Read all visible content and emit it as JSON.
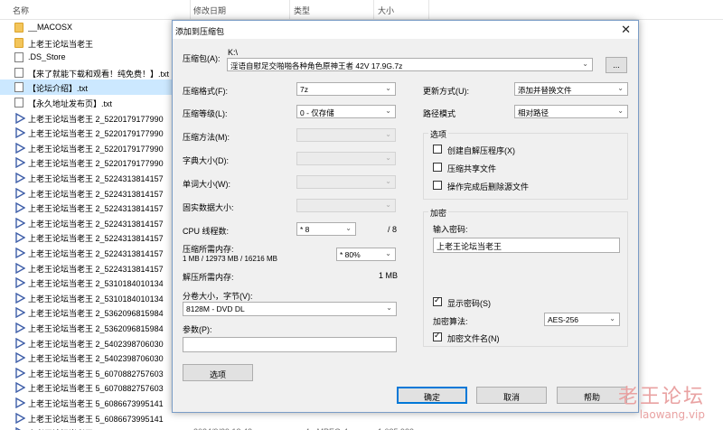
{
  "explorer": {
    "columns": {
      "name": "名称",
      "date": "修改日期",
      "type": "类型",
      "size": "大小"
    },
    "files": [
      {
        "icon": "folder-icon",
        "name": "__MACOSX",
        "date": "",
        "type": "",
        "size": ""
      },
      {
        "icon": "folder-icon",
        "name": "上老王论坛当老王",
        "date": "",
        "type": "",
        "size": ""
      },
      {
        "icon": "document-icon",
        "name": ".DS_Store",
        "date": "",
        "type": "",
        "size": ""
      },
      {
        "icon": "document-icon",
        "name": "【来了就能下载和观看！纯免费！】.txt",
        "date": "",
        "type": "",
        "size": ""
      },
      {
        "icon": "document-icon",
        "name": "【论坛介绍】.txt",
        "date": "",
        "type": "",
        "size": ""
      },
      {
        "icon": "document-icon",
        "name": "【永久地址发布页】.txt",
        "date": "",
        "type": "",
        "size": ""
      },
      {
        "icon": "video-icon",
        "name": "上老王论坛当老王 2_5220179177990",
        "date": "",
        "type": "",
        "size": ""
      },
      {
        "icon": "video-icon",
        "name": "上老王论坛当老王 2_5220179177990",
        "date": "",
        "type": "",
        "size": ""
      },
      {
        "icon": "video-icon",
        "name": "上老王论坛当老王 2_5220179177990",
        "date": "",
        "type": "",
        "size": ""
      },
      {
        "icon": "video-icon",
        "name": "上老王论坛当老王 2_5220179177990",
        "date": "",
        "type": "",
        "size": ""
      },
      {
        "icon": "video-icon",
        "name": "上老王论坛当老王 2_5224313814157",
        "date": "",
        "type": "",
        "size": ""
      },
      {
        "icon": "video-icon",
        "name": "上老王论坛当老王 2_5224313814157",
        "date": "",
        "type": "",
        "size": ""
      },
      {
        "icon": "video-icon",
        "name": "上老王论坛当老王 2_5224313814157",
        "date": "",
        "type": "",
        "size": ""
      },
      {
        "icon": "video-icon",
        "name": "上老王论坛当老王 2_5224313814157",
        "date": "",
        "type": "",
        "size": ""
      },
      {
        "icon": "video-icon",
        "name": "上老王论坛当老王 2_5224313814157",
        "date": "",
        "type": "",
        "size": ""
      },
      {
        "icon": "video-icon",
        "name": "上老王论坛当老王 2_5224313814157",
        "date": "",
        "type": "",
        "size": ""
      },
      {
        "icon": "video-icon",
        "name": "上老王论坛当老王 2_5224313814157",
        "date": "",
        "type": "",
        "size": ""
      },
      {
        "icon": "video-icon",
        "name": "上老王论坛当老王 2_5310184010134",
        "date": "",
        "type": "",
        "size": ""
      },
      {
        "icon": "video-icon",
        "name": "上老王论坛当老王 2_5310184010134",
        "date": "",
        "type": "",
        "size": ""
      },
      {
        "icon": "video-icon",
        "name": "上老王论坛当老王 2_5362096815984",
        "date": "",
        "type": "",
        "size": ""
      },
      {
        "icon": "video-icon",
        "name": "上老王论坛当老王 2_5362096815984",
        "date": "",
        "type": "",
        "size": ""
      },
      {
        "icon": "video-icon",
        "name": "上老王论坛当老王 2_5402398706030",
        "date": "",
        "type": "",
        "size": ""
      },
      {
        "icon": "video-icon",
        "name": "上老王论坛当老王 2_5402398706030",
        "date": "",
        "type": "",
        "size": ""
      },
      {
        "icon": "video-icon",
        "name": "上老王论坛当老王 5_6070882757603",
        "date": "",
        "type": "",
        "size": ""
      },
      {
        "icon": "video-icon",
        "name": "上老王论坛当老王 5_6070882757603",
        "date": "",
        "type": "",
        "size": ""
      },
      {
        "icon": "video-icon",
        "name": "上老王论坛当老王 5_6086673995141",
        "date": "",
        "type": "",
        "size": ""
      },
      {
        "icon": "video-icon",
        "name": "上老王论坛当老王 5_6086673995141",
        "date": "",
        "type": "",
        "size": ""
      },
      {
        "icon": "video-icon",
        "name": "上老王论坛当老王 5_60983134982473...",
        "date": "2024/9/29 13:42",
        "type": "mp4 - MPEG-4 ...",
        "size": "1,035,933..."
      }
    ]
  },
  "dialog": {
    "title": "添加到压缩包",
    "archive_label": "压缩包(A):",
    "archive_path_prefix": "K:\\",
    "archive_name": "淫语自慰足交啪啪各种角色原神王者  42V 17.9G.7z",
    "browse_button": "...",
    "format_label": "压缩格式(F):",
    "format_value": "7z",
    "level_label": "压缩等级(L):",
    "level_value": "0 - 仅存储",
    "method_label": "压缩方法(M):",
    "dict_label": "字典大小(D):",
    "word_label": "单词大小(W):",
    "solid_label": "固实数据大小:",
    "threads_label": "CPU 线程数:",
    "threads_value": "* 8",
    "threads_max": "/ 8",
    "mem_comp_label": "压缩所需内存:",
    "mem_comp_detail": "1 MB / 12973 MB / 16216 MB",
    "mem_percent": "* 80%",
    "mem_decomp_label": "解压所需内存:",
    "mem_decomp_value": "1 MB",
    "split_label": "分卷大小，字节(V):",
    "split_value": "8128M - DVD DL",
    "params_label": "参数(P):",
    "params_value": "",
    "options_button": "选项",
    "update_label": "更新方式(U):",
    "update_value": "添加并替换文件",
    "path_label": "路径模式",
    "path_value": "相对路径",
    "options_group": "选项",
    "opt_sfx": "创建自解压程序(X)",
    "opt_shared": "压缩共享文件",
    "opt_delete": "操作完成后删除源文件",
    "encrypt_group": "加密",
    "password_label": "输入密码:",
    "password_value": "上老王论坛当老王",
    "show_password": "显示密码(S)",
    "enc_method_label": "加密算法:",
    "enc_method_value": "AES-256",
    "enc_names": "加密文件名(N)",
    "ok_button": "确定",
    "cancel_button": "取消",
    "help_button": "帮助"
  },
  "watermark": {
    "text": "老王论坛",
    "url": "laowang.vip"
  }
}
